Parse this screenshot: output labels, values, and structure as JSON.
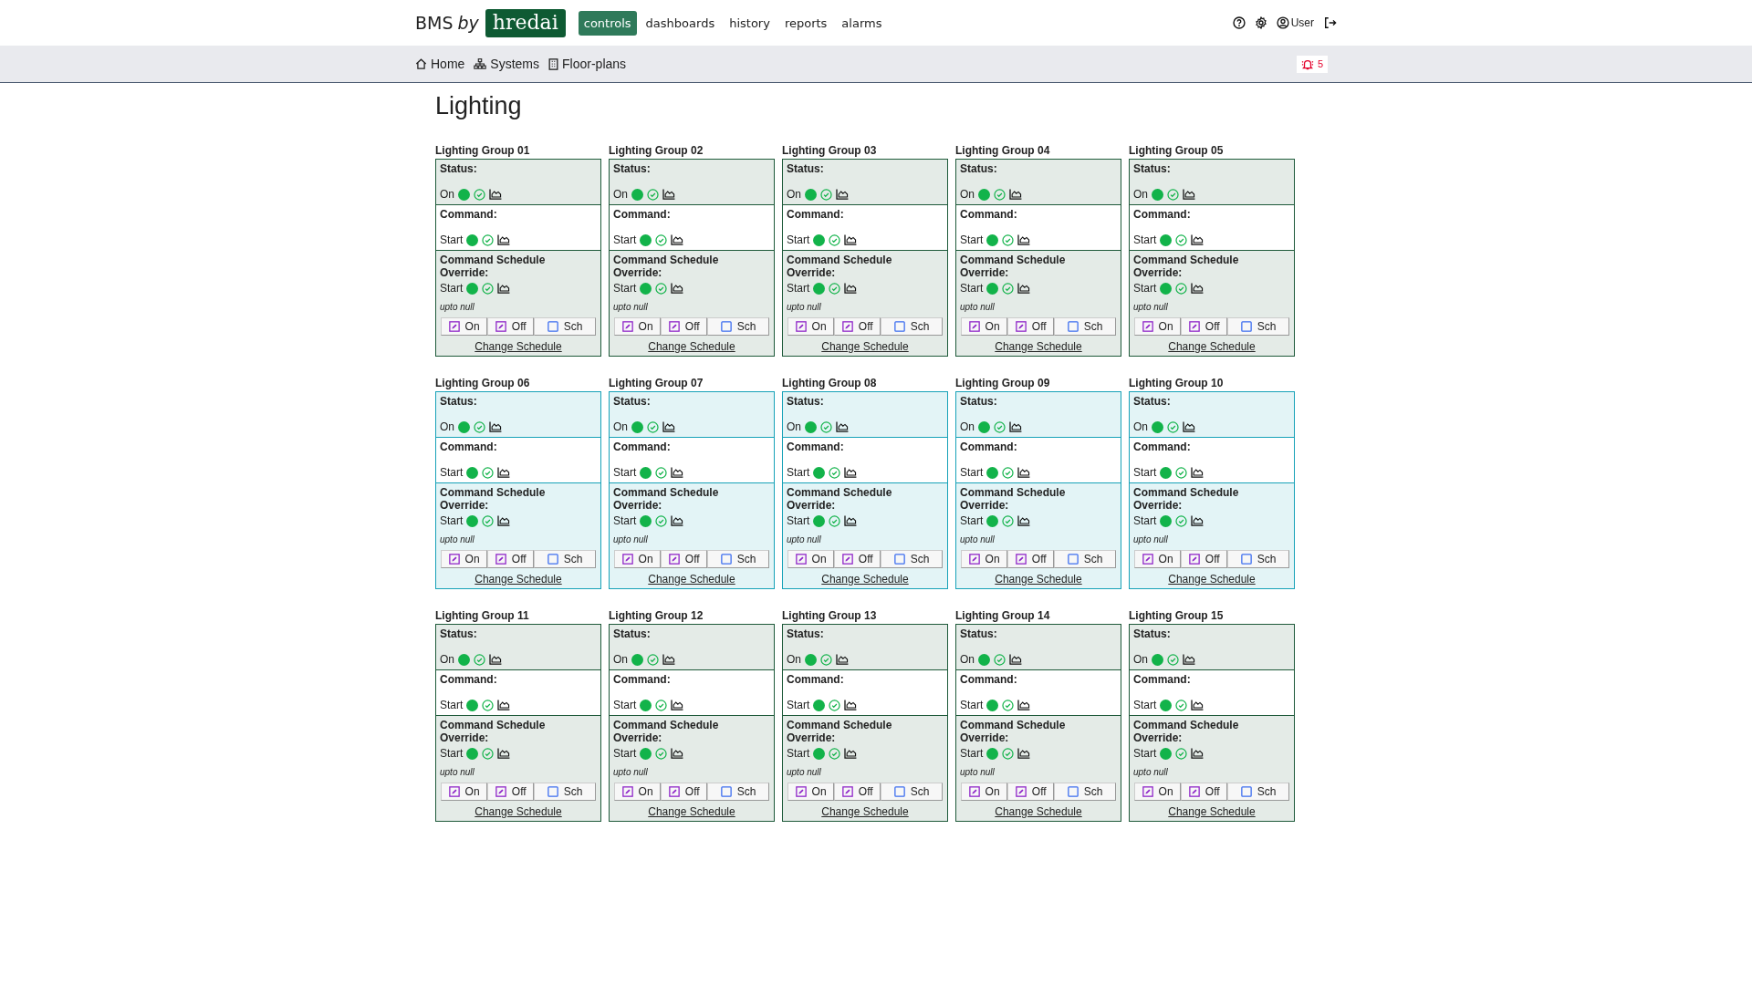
{
  "brand": {
    "prefix": "BMS",
    "by": "by",
    "logo": "hredai"
  },
  "nav": [
    {
      "label": "controls",
      "selected": true
    },
    {
      "label": "dashboards",
      "selected": false
    },
    {
      "label": "history",
      "selected": false
    },
    {
      "label": "reports",
      "selected": false
    },
    {
      "label": "alarms",
      "selected": false
    }
  ],
  "user": {
    "name": "User"
  },
  "subnav": [
    {
      "label": "Home",
      "kind": "home"
    },
    {
      "label": "Systems",
      "kind": "systems"
    },
    {
      "label": "Floor-plans",
      "kind": "building"
    }
  ],
  "alarm_count": "5",
  "page_title": "Lighting",
  "groups": [
    {
      "title": "Lighting Group 01",
      "color": "#1e5a3a",
      "sections": [
        {
          "label": "Status:",
          "value": "On",
          "kind": "tinted"
        },
        {
          "label": "Command:",
          "value": "Start",
          "kind": "plain"
        },
        {
          "label": "Command Schedule Override:",
          "value": "Start",
          "kind": "tinted"
        }
      ],
      "note": "upto null",
      "buttons": [
        {
          "label": "On",
          "kind": "edit"
        },
        {
          "label": "Off",
          "kind": "edit"
        },
        {
          "label": "Sch",
          "kind": "blank"
        }
      ],
      "link": "Change Schedule"
    },
    {
      "title": "Lighting Group 02",
      "color": "#1e5a3a",
      "sections": [
        {
          "label": "Status:",
          "value": "On",
          "kind": "tinted"
        },
        {
          "label": "Command:",
          "value": "Start",
          "kind": "plain"
        },
        {
          "label": "Command Schedule Override:",
          "value": "Start",
          "kind": "tinted"
        }
      ],
      "note": "upto null",
      "buttons": [
        {
          "label": "On",
          "kind": "edit"
        },
        {
          "label": "Off",
          "kind": "edit"
        },
        {
          "label": "Sch",
          "kind": "blank"
        }
      ],
      "link": "Change Schedule"
    },
    {
      "title": "Lighting Group 03",
      "color": "#1e5a3a",
      "sections": [
        {
          "label": "Status:",
          "value": "On",
          "kind": "tinted"
        },
        {
          "label": "Command:",
          "value": "Start",
          "kind": "plain"
        },
        {
          "label": "Command Schedule Override:",
          "value": "Start",
          "kind": "tinted"
        }
      ],
      "note": "upto null",
      "buttons": [
        {
          "label": "On",
          "kind": "edit"
        },
        {
          "label": "Off",
          "kind": "edit"
        },
        {
          "label": "Sch",
          "kind": "blank"
        }
      ],
      "link": "Change Schedule"
    },
    {
      "title": "Lighting Group 04",
      "color": "#1e5a3a",
      "sections": [
        {
          "label": "Status:",
          "value": "On",
          "kind": "tinted"
        },
        {
          "label": "Command:",
          "value": "Start",
          "kind": "plain"
        },
        {
          "label": "Command Schedule Override:",
          "value": "Start",
          "kind": "tinted"
        }
      ],
      "note": "upto null",
      "buttons": [
        {
          "label": "On",
          "kind": "edit"
        },
        {
          "label": "Off",
          "kind": "edit"
        },
        {
          "label": "Sch",
          "kind": "blank"
        }
      ],
      "link": "Change Schedule"
    },
    {
      "title": "Lighting Group 05",
      "color": "#1e5a3a",
      "sections": [
        {
          "label": "Status:",
          "value": "On",
          "kind": "tinted"
        },
        {
          "label": "Command:",
          "value": "Start",
          "kind": "plain"
        },
        {
          "label": "Command Schedule Override:",
          "value": "Start",
          "kind": "tinted"
        }
      ],
      "note": "upto null",
      "buttons": [
        {
          "label": "On",
          "kind": "edit"
        },
        {
          "label": "Off",
          "kind": "edit"
        },
        {
          "label": "Sch",
          "kind": "blank"
        }
      ],
      "link": "Change Schedule"
    },
    {
      "title": "Lighting Group 06",
      "color": "#17a2b8",
      "sections": [
        {
          "label": "Status:",
          "value": "On",
          "kind": "tinted"
        },
        {
          "label": "Command:",
          "value": "Start",
          "kind": "plain"
        },
        {
          "label": "Command Schedule Override:",
          "value": "Start",
          "kind": "tinted"
        }
      ],
      "note": "upto null",
      "buttons": [
        {
          "label": "On",
          "kind": "edit"
        },
        {
          "label": "Off",
          "kind": "edit"
        },
        {
          "label": "Sch",
          "kind": "blank"
        }
      ],
      "link": "Change Schedule"
    },
    {
      "title": "Lighting Group 07",
      "color": "#17a2b8",
      "sections": [
        {
          "label": "Status:",
          "value": "On",
          "kind": "tinted"
        },
        {
          "label": "Command:",
          "value": "Start",
          "kind": "plain"
        },
        {
          "label": "Command Schedule Override:",
          "value": "Start",
          "kind": "tinted"
        }
      ],
      "note": "upto null",
      "buttons": [
        {
          "label": "On",
          "kind": "edit"
        },
        {
          "label": "Off",
          "kind": "edit"
        },
        {
          "label": "Sch",
          "kind": "blank"
        }
      ],
      "link": "Change Schedule"
    },
    {
      "title": "Lighting Group 08",
      "color": "#17a2b8",
      "sections": [
        {
          "label": "Status:",
          "value": "On",
          "kind": "tinted"
        },
        {
          "label": "Command:",
          "value": "Start",
          "kind": "plain"
        },
        {
          "label": "Command Schedule Override:",
          "value": "Start",
          "kind": "tinted"
        }
      ],
      "note": "upto null",
      "buttons": [
        {
          "label": "On",
          "kind": "edit"
        },
        {
          "label": "Off",
          "kind": "edit"
        },
        {
          "label": "Sch",
          "kind": "blank"
        }
      ],
      "link": "Change Schedule"
    },
    {
      "title": "Lighting Group 09",
      "color": "#17a2b8",
      "sections": [
        {
          "label": "Status:",
          "value": "On",
          "kind": "tinted"
        },
        {
          "label": "Command:",
          "value": "Start",
          "kind": "plain"
        },
        {
          "label": "Command Schedule Override:",
          "value": "Start",
          "kind": "tinted"
        }
      ],
      "note": "upto null",
      "buttons": [
        {
          "label": "On",
          "kind": "edit"
        },
        {
          "label": "Off",
          "kind": "edit"
        },
        {
          "label": "Sch",
          "kind": "blank"
        }
      ],
      "link": "Change Schedule"
    },
    {
      "title": "Lighting Group 10",
      "color": "#17a2b8",
      "sections": [
        {
          "label": "Status:",
          "value": "On",
          "kind": "tinted"
        },
        {
          "label": "Command:",
          "value": "Start",
          "kind": "plain"
        },
        {
          "label": "Command Schedule Override:",
          "value": "Start",
          "kind": "tinted"
        }
      ],
      "note": "upto null",
      "buttons": [
        {
          "label": "On",
          "kind": "edit"
        },
        {
          "label": "Off",
          "kind": "edit"
        },
        {
          "label": "Sch",
          "kind": "blank"
        }
      ],
      "link": "Change Schedule"
    },
    {
      "title": "Lighting Group 11",
      "color": "#1e5a3a",
      "sections": [
        {
          "label": "Status:",
          "value": "On",
          "kind": "tinted"
        },
        {
          "label": "Command:",
          "value": "Start",
          "kind": "plain"
        },
        {
          "label": "Command Schedule Override:",
          "value": "Start",
          "kind": "tinted"
        }
      ],
      "note": "upto null",
      "buttons": [
        {
          "label": "On",
          "kind": "edit"
        },
        {
          "label": "Off",
          "kind": "edit"
        },
        {
          "label": "Sch",
          "kind": "blank"
        }
      ],
      "link": "Change Schedule"
    },
    {
      "title": "Lighting Group 12",
      "color": "#1e5a3a",
      "sections": [
        {
          "label": "Status:",
          "value": "On",
          "kind": "tinted"
        },
        {
          "label": "Command:",
          "value": "Start",
          "kind": "plain"
        },
        {
          "label": "Command Schedule Override:",
          "value": "Start",
          "kind": "tinted"
        }
      ],
      "note": "upto null",
      "buttons": [
        {
          "label": "On",
          "kind": "edit"
        },
        {
          "label": "Off",
          "kind": "edit"
        },
        {
          "label": "Sch",
          "kind": "blank"
        }
      ],
      "link": "Change Schedule"
    },
    {
      "title": "Lighting Group 13",
      "color": "#1e5a3a",
      "sections": [
        {
          "label": "Status:",
          "value": "On",
          "kind": "tinted"
        },
        {
          "label": "Command:",
          "value": "Start",
          "kind": "plain"
        },
        {
          "label": "Command Schedule Override:",
          "value": "Start",
          "kind": "tinted"
        }
      ],
      "note": "upto null",
      "buttons": [
        {
          "label": "On",
          "kind": "edit"
        },
        {
          "label": "Off",
          "kind": "edit"
        },
        {
          "label": "Sch",
          "kind": "blank"
        }
      ],
      "link": "Change Schedule"
    },
    {
      "title": "Lighting Group 14",
      "color": "#1e5a3a",
      "sections": [
        {
          "label": "Status:",
          "value": "On",
          "kind": "tinted"
        },
        {
          "label": "Command:",
          "value": "Start",
          "kind": "plain"
        },
        {
          "label": "Command Schedule Override:",
          "value": "Start",
          "kind": "tinted"
        }
      ],
      "note": "upto null",
      "buttons": [
        {
          "label": "On",
          "kind": "edit"
        },
        {
          "label": "Off",
          "kind": "edit"
        },
        {
          "label": "Sch",
          "kind": "blank"
        }
      ],
      "link": "Change Schedule"
    },
    {
      "title": "Lighting Group 15",
      "color": "#1e5a3a",
      "sections": [
        {
          "label": "Status:",
          "value": "On",
          "kind": "tinted"
        },
        {
          "label": "Command:",
          "value": "Start",
          "kind": "plain"
        },
        {
          "label": "Command Schedule Override:",
          "value": "Start",
          "kind": "tinted"
        }
      ],
      "note": "upto null",
      "buttons": [
        {
          "label": "On",
          "kind": "edit"
        },
        {
          "label": "Off",
          "kind": "edit"
        },
        {
          "label": "Sch",
          "kind": "blank"
        }
      ],
      "link": "Change Schedule"
    }
  ]
}
